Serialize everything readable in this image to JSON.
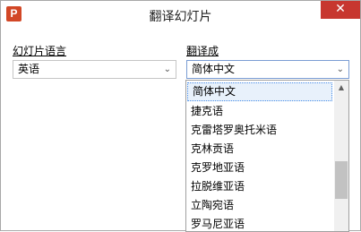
{
  "window": {
    "title": "翻译幻灯片",
    "app_icon_letter": "P",
    "close_symbol": "✕"
  },
  "source": {
    "label": "幻灯片语言",
    "value": "英语"
  },
  "target": {
    "label": "翻译成",
    "value": "简体中文",
    "options": [
      "简体中文",
      "捷克语",
      "克雷塔罗奥托米语",
      "克林贡语",
      "克罗地亚语",
      "拉脱维亚语",
      "立陶宛语",
      "罗马尼亚语"
    ],
    "selected_index": 0
  },
  "icons": {
    "dropdown_chevron": "chevron-down",
    "scroll_up": "scroll-up-arrow"
  }
}
